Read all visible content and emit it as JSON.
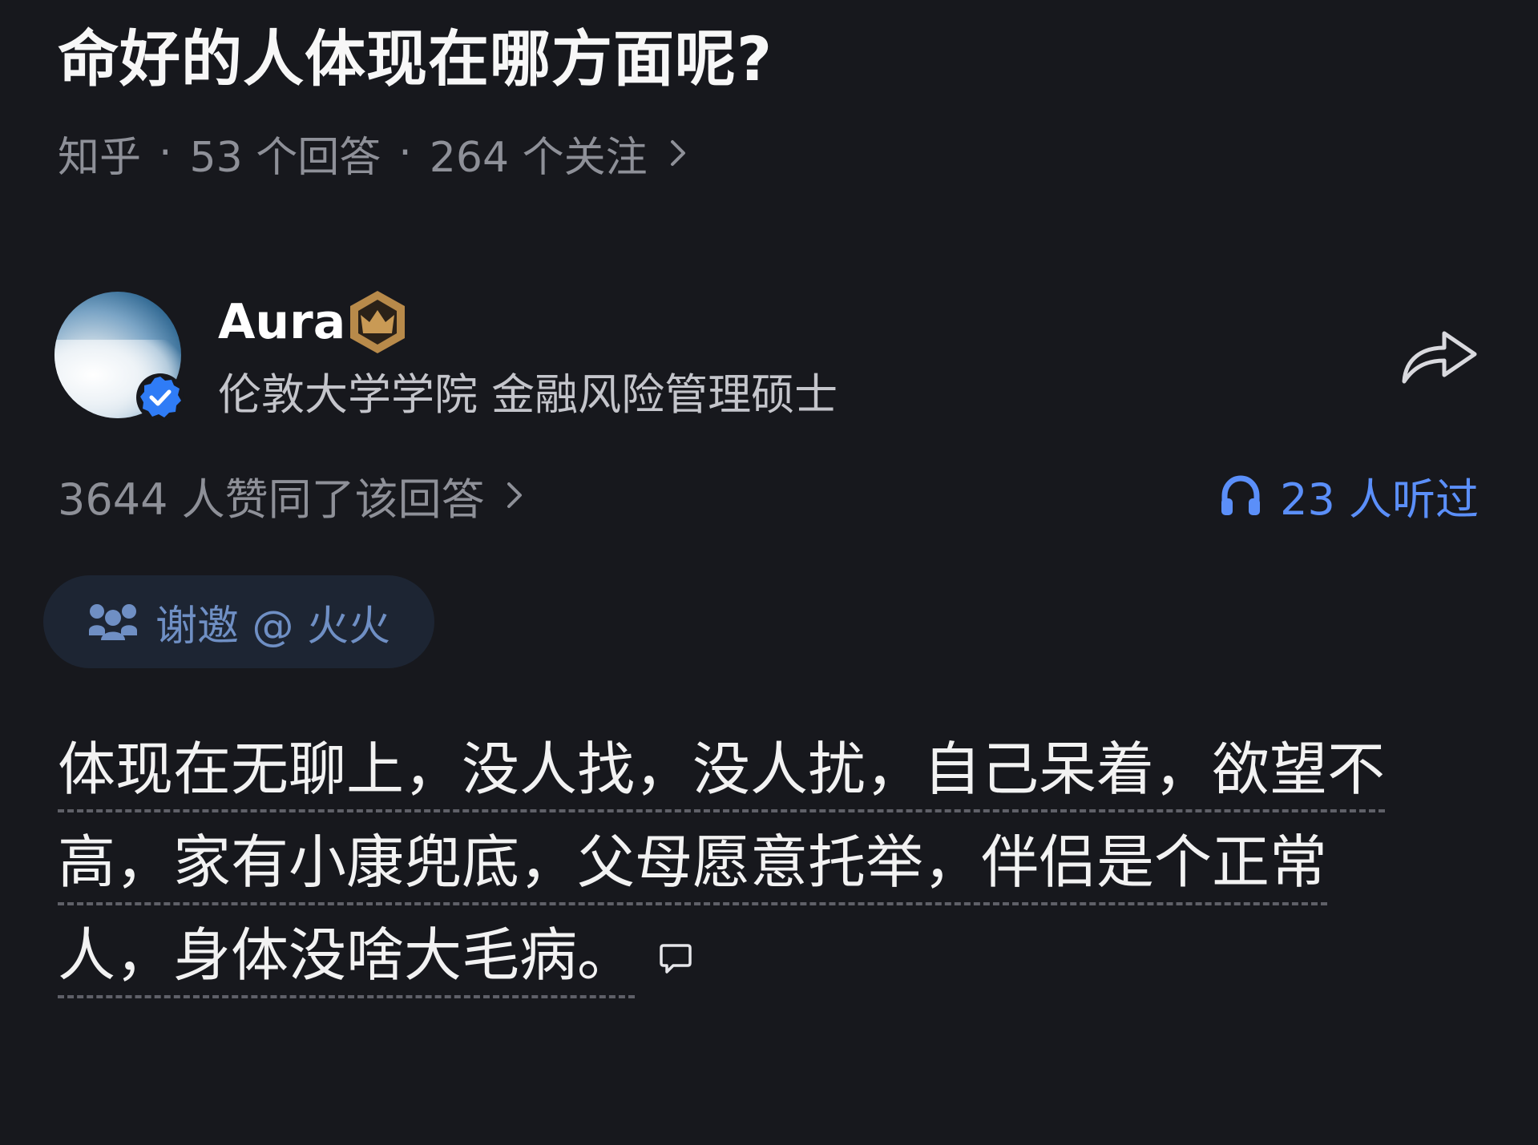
{
  "question": {
    "title": "命好的人体现在哪方面呢?",
    "source": "知乎",
    "separator": "·",
    "answers_count": "53 个回答",
    "followers_count": "264 个关注"
  },
  "author": {
    "name": "Aura",
    "bio": "伦敦大学学院 金融风险管理硕士",
    "verified": true,
    "badge_icon": "crown-badge-icon"
  },
  "stats": {
    "upvotes": "3644 人赞同了该回答",
    "listened": "23 人听过"
  },
  "invite": {
    "label": "谢邀 @ 火火"
  },
  "answer": {
    "lines": [
      "体现在无聊上，没人找，没人扰，自己呆着，欲望不",
      "高，家有小康兜底，父母愿意托举，伴侣是个正常",
      "人，身体没啥大毛病。"
    ]
  },
  "colors": {
    "background": "#17181d",
    "accent_blue": "#5b8ff9",
    "muted_text": "#8e9098",
    "chip_background": "#1d2533",
    "crown_gold": "#b88a4a"
  }
}
